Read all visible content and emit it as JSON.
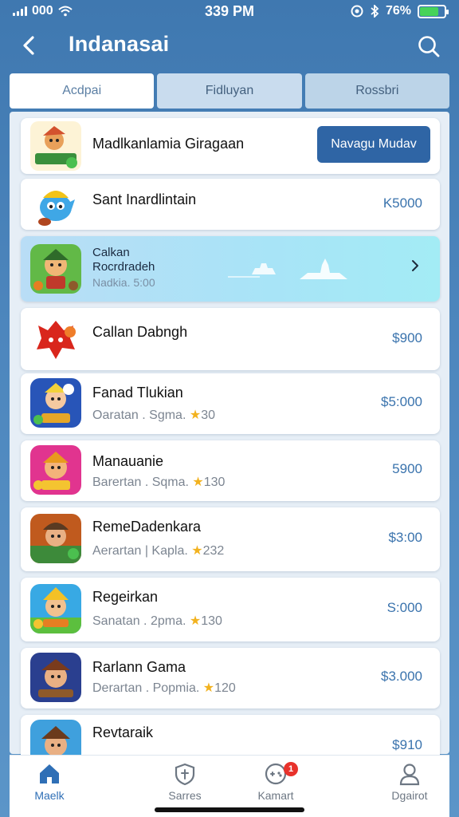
{
  "status_bar": {
    "carrier": "000",
    "time": "339 PM",
    "battery_text": "76%",
    "battery_level": 0.76,
    "battery_color": "#46d35a"
  },
  "header": {
    "title": "Indanasai"
  },
  "tabs": [
    {
      "label": "Acdpai"
    },
    {
      "label": "Fidluyan"
    },
    {
      "label": "Rossbri"
    }
  ],
  "promo": {
    "name": "Madlkanlamia Giragaan",
    "button_label": "Navagu Mudav"
  },
  "items": [
    {
      "name": "Sant Inardlintain",
      "meta": "",
      "rating": "",
      "price": "K5000"
    },
    {
      "name": "Callan Dabngh",
      "meta": "",
      "rating": "",
      "price": "$900"
    },
    {
      "name": "Fanad Tlukian",
      "meta": "Oaratan . Sgma. ",
      "rating": "30",
      "price": "$5:000"
    },
    {
      "name": "Manauanie",
      "meta": "Barertan . Sqma. ",
      "rating": "130",
      "price": "5900"
    },
    {
      "name": "RemeDadenkara",
      "meta": "Aerartan | Kapla. ",
      "rating": "232",
      "price": "$3:00"
    },
    {
      "name": "Regeirkan",
      "meta": "Sanatan . 2pma. ",
      "rating": "130",
      "price": "S:000"
    },
    {
      "name": "Rarlann Gama",
      "meta": "Derartan . Popmia. ",
      "rating": "120",
      "price": "$3.000"
    },
    {
      "name": "Revtaraik",
      "meta": "",
      "rating": "",
      "price": "$910"
    }
  ],
  "featured": {
    "name_line1": "Calkan",
    "name_line2": "Rocrdradeh",
    "meta": "Nadkia. 5:00"
  },
  "bottom_nav": [
    {
      "label": "Maelk",
      "icon": "home-icon"
    },
    {
      "label": "Sarres",
      "icon": "shield-icon"
    },
    {
      "label": "Kamart",
      "icon": "gamepad-icon",
      "badge": "1"
    },
    {
      "label": "Dgairot",
      "icon": "profile-icon"
    }
  ],
  "colors": {
    "accent": "#2f65a5",
    "price": "#3a73ad",
    "star": "#f2b21f",
    "badge": "#e8322b"
  }
}
